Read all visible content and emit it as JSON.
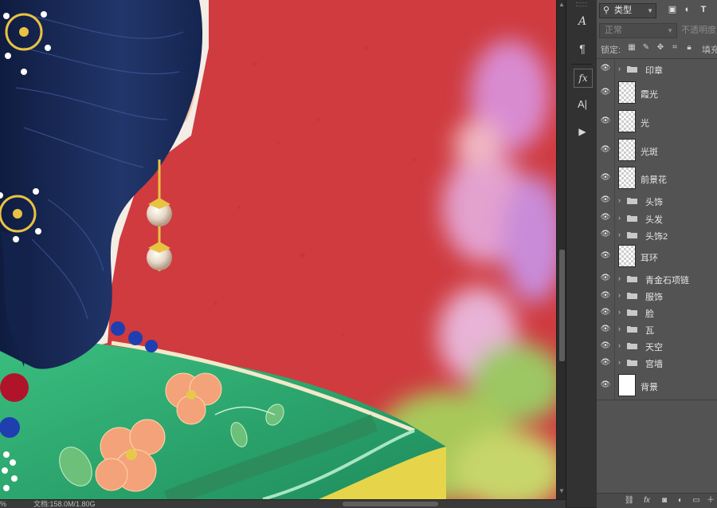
{
  "status": {
    "zoom": "%",
    "doc": "文档:158.0M/1.80G"
  },
  "tools": {
    "character_icon": "A",
    "paragraph_icon": "¶",
    "fx_icon": "fx",
    "char_style_icon": "A|",
    "play_icon": "▶"
  },
  "layers_panel": {
    "filter_kind": "类型",
    "blend_mode": "正常",
    "opacity_label": "不透明度",
    "lock_label": "锁定:",
    "fill_label": "填充",
    "layers": [
      {
        "name": "印章",
        "type": "group"
      },
      {
        "name": "霞光",
        "type": "layer"
      },
      {
        "name": "光",
        "type": "layer"
      },
      {
        "name": "光斑",
        "type": "layer"
      },
      {
        "name": "前景花",
        "type": "layer"
      },
      {
        "name": "头饰",
        "type": "group"
      },
      {
        "name": "头发",
        "type": "group"
      },
      {
        "name": "头饰2",
        "type": "group"
      },
      {
        "name": "耳环",
        "type": "layer"
      },
      {
        "name": "青金石项链",
        "type": "group"
      },
      {
        "name": "服饰",
        "type": "group"
      },
      {
        "name": "脸",
        "type": "group"
      },
      {
        "name": "瓦",
        "type": "group"
      },
      {
        "name": "天空",
        "type": "group"
      },
      {
        "name": "宫墙",
        "type": "group"
      },
      {
        "name": "背景",
        "type": "background"
      }
    ]
  },
  "colors": {
    "wall_red": "#cf3b3f",
    "hair_navy": "#1b2a56",
    "robe_green": "#2fa06a",
    "flower_peach": "#f29b6e",
    "gold": "#e8c243",
    "panel_bg": "#535353"
  }
}
